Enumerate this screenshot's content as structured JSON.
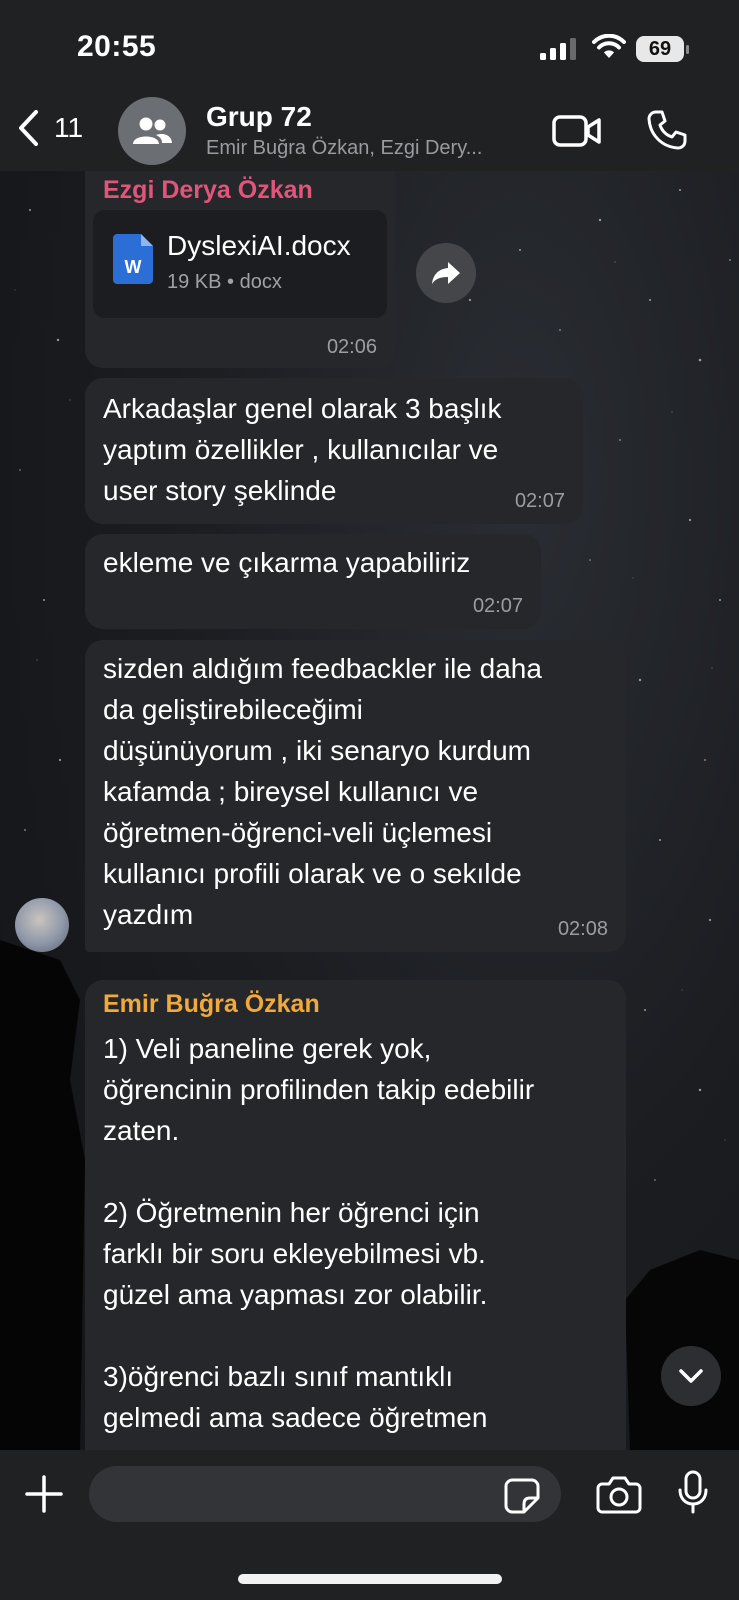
{
  "status_bar": {
    "time": "20:55",
    "battery": "69"
  },
  "header": {
    "back_count": "11",
    "title": "Grup 72",
    "subtitle": "Emir Buğra Özkan, Ezgi Dery..."
  },
  "messages": [
    {
      "sender": "Ezgi Derya Özkan",
      "sender_color": "#e0557a",
      "attachment": {
        "name": "DyslexiAI.docx",
        "meta": "19 KB • docx",
        "icon": "word-doc-icon",
        "icon_letter": "W"
      },
      "time": "02:06"
    },
    {
      "text": "Arkadaşlar genel olarak 3 başlık\nyaptım özellikler , kullanıcılar ve\nuser story şeklinde",
      "time": "02:07"
    },
    {
      "text": "ekleme ve çıkarma yapabiliriz",
      "time": "02:07"
    },
    {
      "text": "sizden aldığım feedbackler ile daha\nda geliştirebileceğimi\ndüşünüyorum , iki senaryo kurdum\nkafamda ; bireysel kullanıcı ve\nöğretmen-öğrenci-veli üçlemesi\nkullanıcı profili olarak ve o sekılde\nyazdım",
      "time": "02:08"
    },
    {
      "sender": "Emir Buğra Özkan",
      "sender_color": "#f0a93a",
      "text": "1) Veli paneline gerek yok,\nöğrencinin profilinden takip edebilir\nzaten.\n\n2) Öğretmenin her öğrenci için\nfarklı bir soru ekleyebilmesi vb.\ngüzel ama yapması zor olabilir.\n\n3)öğrenci bazlı sınıf mantıklı\ngelmedi ama sadece öğretmen"
    }
  ],
  "composer": {
    "placeholder": ""
  },
  "colors": {
    "bubble": "#26272a",
    "bar": "#202123",
    "word_blue": "#2b6fd6"
  }
}
